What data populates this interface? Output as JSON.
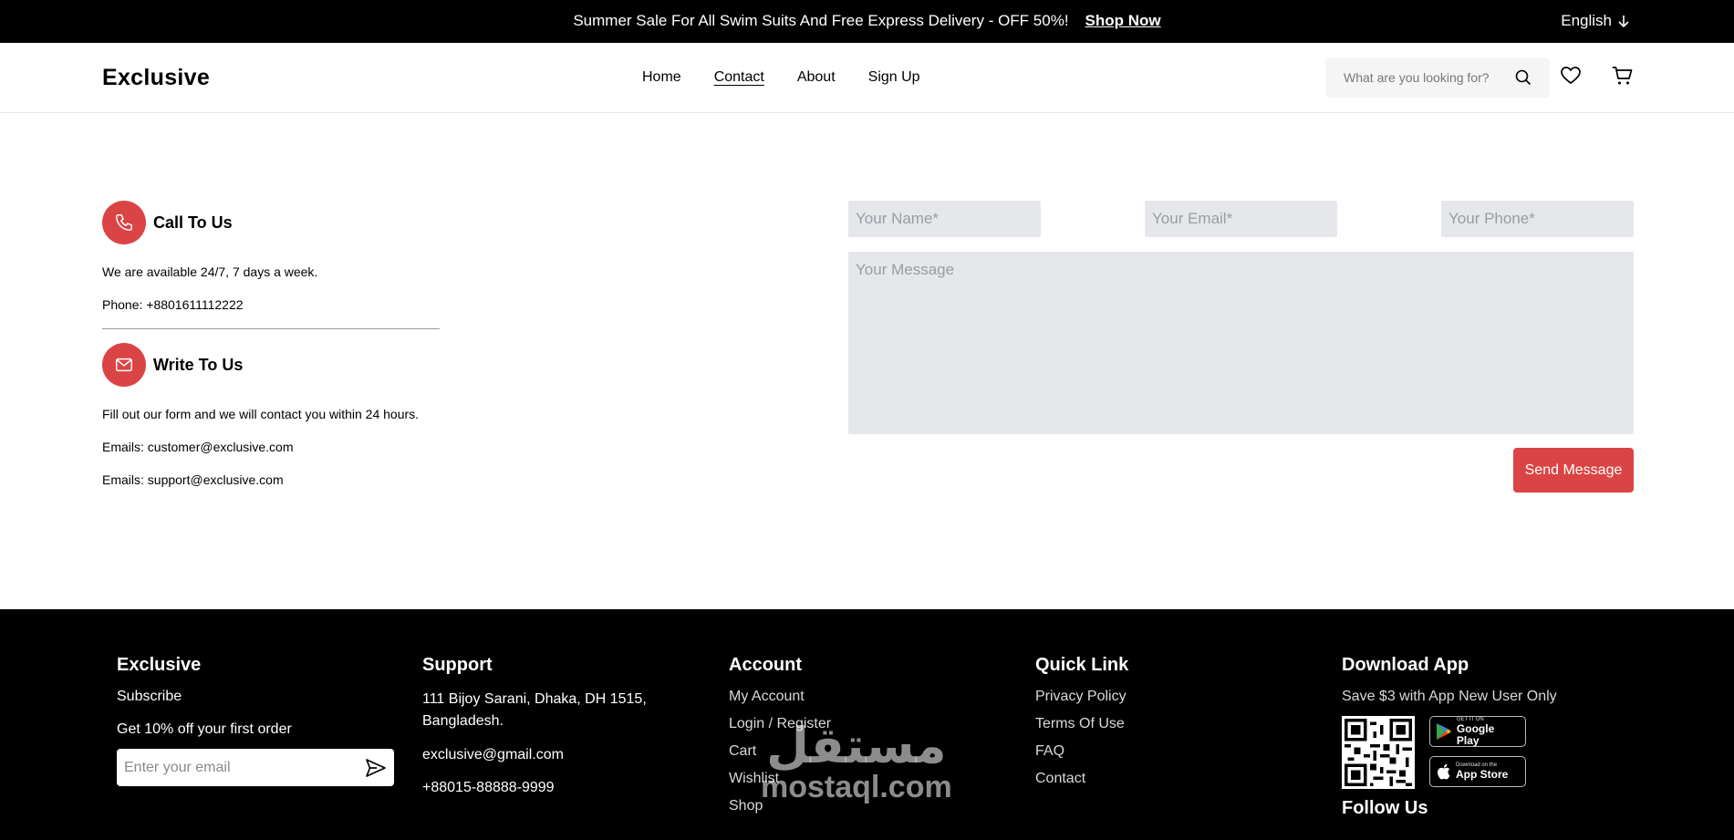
{
  "topbar": {
    "promo": "Summer Sale For All Swim Suits And Free Express Delivery - OFF 50%!",
    "shop_now": "Shop Now",
    "language": "English"
  },
  "header": {
    "logo": "Exclusive",
    "nav": [
      "Home",
      "Contact",
      "About",
      "Sign Up"
    ],
    "active_nav": "Contact",
    "search_placeholder": "What are you looking for?",
    "icons": [
      "search-icon",
      "heart-icon",
      "cart-icon"
    ]
  },
  "contact": {
    "call": {
      "title": "Call To Us",
      "line1": "We are available 24/7, 7 days a week.",
      "line2": "Phone: +8801611112222"
    },
    "write": {
      "title": "Write To Us",
      "line1": "Fill out our form and we will contact you within 24 hours.",
      "line2": "Emails: customer@exclusive.com",
      "line3": "Emails: support@exclusive.com"
    },
    "accent_color": "#db4444"
  },
  "form": {
    "name_placeholder": "Your Name*",
    "email_placeholder": "Your Email*",
    "phone_placeholder": "Your Phone*",
    "message_placeholder": "Your Message",
    "submit_label": "Send Message"
  },
  "footer": {
    "exclusive": {
      "title": "Exclusive",
      "subscribe": "Subscribe",
      "offer": "Get 10% off your first order",
      "email_placeholder": "Enter your email"
    },
    "support": {
      "title": "Support",
      "address": "111 Bijoy Sarani, Dhaka, DH 1515, Bangladesh.",
      "email": "exclusive@gmail.com",
      "phone": "+88015-88888-9999"
    },
    "account": {
      "title": "Account",
      "links": [
        "My Account",
        "Login / Register",
        "Cart",
        "Wishlist",
        "Shop"
      ]
    },
    "quick_link": {
      "title": "Quick Link",
      "links": [
        "Privacy Policy",
        "Terms Of Use",
        "FAQ",
        "Contact"
      ]
    },
    "download": {
      "title": "Download App",
      "note": "Save $3 with App New User Only",
      "google_small": "GET IT ON",
      "google_big": "Google Play",
      "apple_small": "Download on the",
      "apple_big": "App Store",
      "follow": "Follow Us"
    }
  },
  "watermark": {
    "arabic": "مستقل",
    "latin": "mostaql.com"
  }
}
